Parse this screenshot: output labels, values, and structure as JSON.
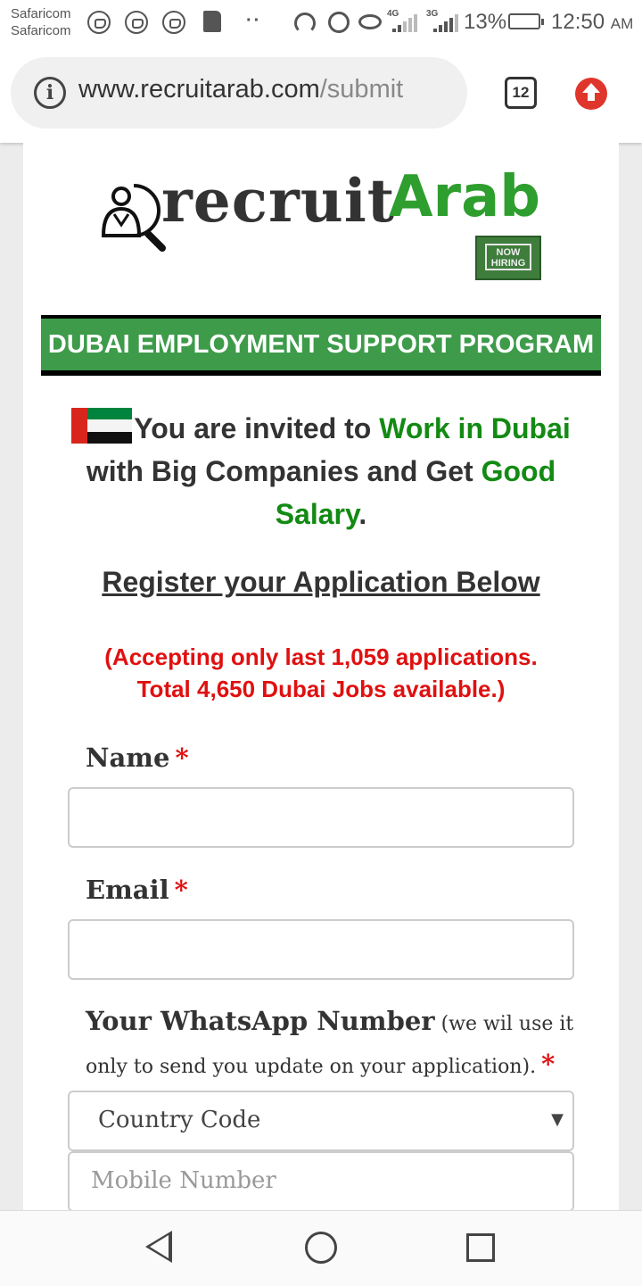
{
  "status_bar": {
    "carrier1": "Safaricom",
    "carrier2": "Safaricom",
    "network1": "4G",
    "network2": "3G",
    "battery": "13%",
    "time": "12:50",
    "ampm": "AM",
    "icons": [
      "whatsapp-icon",
      "whatsapp-icon",
      "whatsapp-icon",
      "sd-card-icon",
      "hotspot-icon",
      "alarm-icon",
      "eye-icon",
      "signal-icon",
      "battery-icon"
    ]
  },
  "browser": {
    "url_host": "www.recruitarab.com",
    "url_path": "/submit",
    "tab_count": "12"
  },
  "logo": {
    "part1": "recruit",
    "part2": "Arab",
    "badge_line1": "NOW",
    "badge_line2": "HIRING"
  },
  "banner": {
    "text": "DUBAI EMPLOYMENT SUPPORT PROGRAM"
  },
  "invite": {
    "t1": "You are invited to ",
    "t2": "Work in Dubai",
    "t3": " with Big Companies and Get ",
    "t4": "Good Salary",
    "t5": "."
  },
  "register": "Register your Application Below",
  "accepting": {
    "line1": "(Accepting only last 1,059 applications.",
    "line2": "Total 4,650 Dubai Jobs available.)"
  },
  "form": {
    "name_label": "Name",
    "email_label": "Email",
    "whatsapp_label": "Your WhatsApp Number",
    "whatsapp_note": " (we wil use it only to send you update on your application).",
    "required_mark": "*",
    "country_code": "Country Code",
    "mobile_placeholder": "Mobile Number",
    "caret": "▼"
  },
  "colors": {
    "brand_green": "#2e9e2e",
    "banner_green": "#3d9b4a",
    "accent_red": "#e01010",
    "text_green": "#138a13"
  }
}
